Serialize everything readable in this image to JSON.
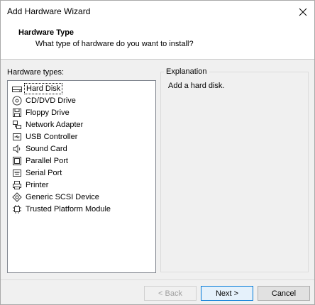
{
  "window": {
    "title": "Add Hardware Wizard"
  },
  "header": {
    "title": "Hardware Type",
    "subtitle": "What type of hardware do you want to install?"
  },
  "hardware_list": {
    "label": "Hardware types:",
    "selected_index": 0,
    "items": [
      {
        "label": "Hard Disk",
        "icon": "hard-disk-icon"
      },
      {
        "label": "CD/DVD Drive",
        "icon": "cd-dvd-icon"
      },
      {
        "label": "Floppy Drive",
        "icon": "floppy-icon"
      },
      {
        "label": "Network Adapter",
        "icon": "network-adapter-icon"
      },
      {
        "label": "USB Controller",
        "icon": "usb-icon"
      },
      {
        "label": "Sound Card",
        "icon": "speaker-icon"
      },
      {
        "label": "Parallel Port",
        "icon": "parallel-port-icon"
      },
      {
        "label": "Serial Port",
        "icon": "serial-port-icon"
      },
      {
        "label": "Printer",
        "icon": "printer-icon"
      },
      {
        "label": "Generic SCSI Device",
        "icon": "scsi-icon"
      },
      {
        "label": "Trusted Platform Module",
        "icon": "tpm-icon"
      }
    ]
  },
  "explanation": {
    "legend": "Explanation",
    "text": "Add a hard disk."
  },
  "buttons": {
    "back": "< Back",
    "next": "Next >",
    "cancel": "Cancel"
  },
  "colors": {
    "accent": "#0078d7",
    "window_bg": "#f0f0f0"
  }
}
